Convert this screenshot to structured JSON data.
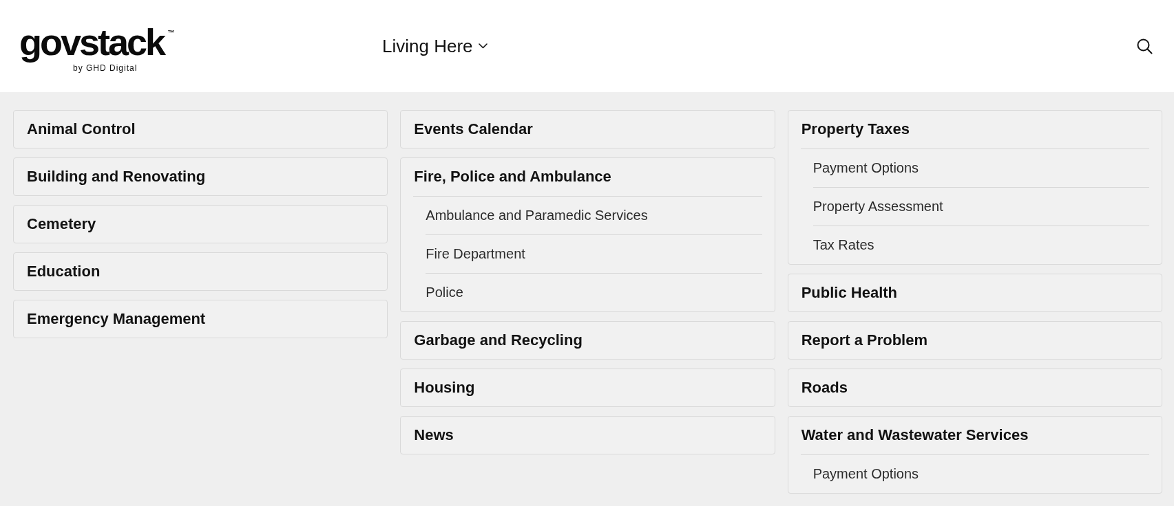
{
  "header": {
    "logo": {
      "wordmark": "govstack",
      "trademark": "™",
      "tagline": "by GHD Digital"
    },
    "nav": [
      {
        "label": "Living Here"
      }
    ]
  },
  "menu": {
    "columns": [
      {
        "items": [
          {
            "label": "Animal Control"
          },
          {
            "label": "Building and Renovating"
          },
          {
            "label": "Cemetery"
          },
          {
            "label": "Education"
          },
          {
            "label": "Emergency Management"
          }
        ]
      },
      {
        "items": [
          {
            "label": "Events Calendar"
          },
          {
            "label": "Fire, Police and Ambulance",
            "children": [
              {
                "label": "Ambulance and Paramedic Services"
              },
              {
                "label": "Fire Department"
              },
              {
                "label": "Police"
              }
            ]
          },
          {
            "label": "Garbage and Recycling"
          },
          {
            "label": "Housing"
          },
          {
            "label": "News"
          }
        ]
      },
      {
        "items": [
          {
            "label": "Property Taxes",
            "children": [
              {
                "label": "Payment Options"
              },
              {
                "label": "Property Assessment"
              },
              {
                "label": "Tax Rates"
              }
            ]
          },
          {
            "label": "Public Health"
          },
          {
            "label": "Report a Problem"
          },
          {
            "label": "Roads"
          },
          {
            "label": "Water and Wastewater Services",
            "children": [
              {
                "label": "Payment Options"
              }
            ]
          }
        ]
      }
    ]
  }
}
